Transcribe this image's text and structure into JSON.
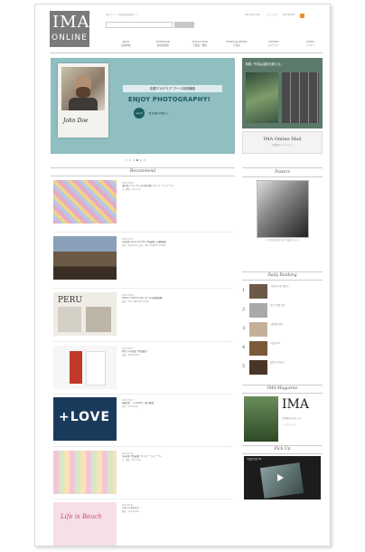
{
  "logo": {
    "line1": "IMA",
    "line2": "ONLINE"
  },
  "header": {
    "tagline": "写真 アート・写真の総合情報サイト",
    "search_placeholder": "",
    "links": [
      "IMA Online Mail",
      "ショッピング",
      "IMA ONLINE"
    ]
  },
  "nav": [
    {
      "label": "NEWS",
      "sub": "最新情報"
    },
    {
      "label": "EXHIBITION",
      "sub": "展覧会情報"
    },
    {
      "label": "PUBLICATION",
      "sub": "写真集・書籍"
    },
    {
      "label": "PHOTOGRAPHERS",
      "sub": "写真家"
    },
    {
      "label": "CONTEST",
      "sub": "コンテスト"
    },
    {
      "label": "EVENT",
      "sub": "イベント"
    }
  ],
  "hero": {
    "banner_title": "田原アカデミア アート特別講座",
    "headline": "ENJOY PHOTOGRAPHY!",
    "vol": "vol.2",
    "subtitle": "写真家の眼力",
    "signature": "John Doe",
    "carousel_active": 4
  },
  "side_banner": {
    "title": "特集「写真は芸術を超える」"
  },
  "mail": {
    "title": "IMA Online Mail",
    "sub": "写真情報メールマガジン"
  },
  "main": {
    "section_title": "Recommend",
    "articles": [
      {
        "date": "2013.05.08",
        "title": "第1回 ベトナム写真の旅 ストリートアート",
        "meta": "文・撮影：John Doe"
      },
      {
        "date": "2013.05.07",
        "title": "写真家 Jane Smith 作品展 公開講座",
        "meta": "日時：2013年5月 会場：IMA CONCEPT STORE"
      },
      {
        "date": "2013.05.06",
        "title": "PERU TOKYO No.17 写真展開催",
        "meta": "会場：IMA CONCEPT STORE"
      },
      {
        "date": "2013.05.04",
        "title": "新刊 写真集 作品紹介",
        "meta": "出版：IMA BOOKS"
      },
      {
        "date": "2013.05.03",
        "title": "展覧会「+LOVE」展 開催",
        "meta": "日時：2013年5月"
      },
      {
        "date": "2013.05.02",
        "title": "写真家 作品展 ストリートアート",
        "meta": "文・撮影：John Doe"
      },
      {
        "date": "2013.05.01",
        "title": "Life is Beach",
        "meta": "撮影：Jane Smith"
      }
    ],
    "thumb_labels": {
      "peru": "PERU",
      "love": "+LOVE",
      "beach": "Life is Beach"
    }
  },
  "sidebar": {
    "posters_title": "Posters",
    "poster_caption": "ライカ生誕百周年記念 写真展 ポスター",
    "ranking_title": "Daily Ranking",
    "ranking": [
      {
        "rank": "1",
        "title": "写真家の作品 展覧会"
      },
      {
        "rank": "2",
        "title": "新刊 写真集 発売"
      },
      {
        "rank": "3",
        "title": "公開講座 開催"
      },
      {
        "rank": "4",
        "title": "写真展 IMA"
      },
      {
        "rank": "5",
        "title": "展覧会 作品紹介"
      }
    ],
    "magazine_title": "IMA Magazine",
    "magazine_logo": "IMA",
    "magazine_links": [
      "定期購読のお申し込み",
      "バックナンバー"
    ],
    "pickup_title": "Pick Up",
    "pickup_caption": "写真集 特集 IMA"
  },
  "colors": {
    "accent": "#1e5d62",
    "hero_bg": "#8fbfc0",
    "logo_bg": "#7a7a7a",
    "feed": "#f08c2a"
  }
}
